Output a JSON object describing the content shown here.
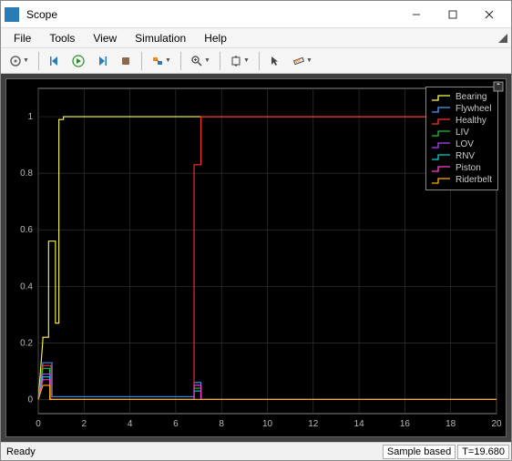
{
  "window": {
    "title": "Scope"
  },
  "menu": {
    "file": "File",
    "tools": "Tools",
    "view": "View",
    "simulation": "Simulation",
    "help": "Help"
  },
  "status": {
    "ready": "Ready",
    "mode": "Sample based",
    "time": "T=19.680"
  },
  "legend": {
    "items": [
      {
        "label": "Bearing",
        "color": "#ffff4d"
      },
      {
        "label": "Flywheel",
        "color": "#3fa0ff"
      },
      {
        "label": "Healthy",
        "color": "#ff3030"
      },
      {
        "label": "LIV",
        "color": "#20c040"
      },
      {
        "label": "LOV",
        "color": "#b040ff"
      },
      {
        "label": "RNV",
        "color": "#00d0d0"
      },
      {
        "label": "Piston",
        "color": "#ff40d0"
      },
      {
        "label": "Riderbelt",
        "color": "#ffb000"
      }
    ]
  },
  "chart_data": {
    "type": "line",
    "xlim": [
      0,
      20
    ],
    "ylim": [
      -0.05,
      1.1
    ],
    "xticks": [
      0,
      2,
      4,
      6,
      8,
      10,
      12,
      14,
      16,
      18,
      20
    ],
    "yticks": [
      0,
      0.2,
      0.4,
      0.6,
      0.8,
      1
    ],
    "series": [
      {
        "name": "Bearing",
        "color": "#ffff4d",
        "points": [
          [
            0,
            0
          ],
          [
            0.2,
            0.21
          ],
          [
            0.2,
            0.22
          ],
          [
            0.45,
            0.22
          ],
          [
            0.45,
            0.56
          ],
          [
            0.75,
            0.56
          ],
          [
            0.75,
            0.27
          ],
          [
            0.9,
            0.27
          ],
          [
            0.9,
            0.99
          ],
          [
            1.1,
            0.99
          ],
          [
            1.1,
            1.0
          ],
          [
            20,
            1.0
          ]
        ]
      },
      {
        "name": "Flywheel",
        "color": "#3fa0ff",
        "points": [
          [
            0,
            0
          ],
          [
            0.2,
            0.13
          ],
          [
            0.6,
            0.13
          ],
          [
            0.6,
            0.01
          ],
          [
            6.8,
            0.01
          ],
          [
            6.8,
            0.06
          ],
          [
            7.1,
            0.06
          ],
          [
            7.1,
            0.0
          ],
          [
            20,
            0.0
          ]
        ]
      },
      {
        "name": "Healthy",
        "color": "#ff3030",
        "points": [
          [
            0,
            0
          ],
          [
            0.2,
            0.12
          ],
          [
            0.55,
            0.12
          ],
          [
            0.55,
            0.0
          ],
          [
            6.8,
            0.0
          ],
          [
            6.8,
            0.83
          ],
          [
            7.1,
            0.83
          ],
          [
            7.1,
            1.0
          ],
          [
            20,
            1.0
          ]
        ]
      },
      {
        "name": "LIV",
        "color": "#20c040",
        "points": [
          [
            0,
            0
          ],
          [
            0.2,
            0.11
          ],
          [
            0.5,
            0.11
          ],
          [
            0.5,
            0.0
          ],
          [
            6.8,
            0.0
          ],
          [
            6.8,
            0.04
          ],
          [
            7.1,
            0.04
          ],
          [
            7.1,
            0.0
          ],
          [
            20,
            0.0
          ]
        ]
      },
      {
        "name": "LOV",
        "color": "#b040ff",
        "points": [
          [
            0,
            0
          ],
          [
            0.2,
            0.09
          ],
          [
            0.5,
            0.09
          ],
          [
            0.5,
            0.0
          ],
          [
            20,
            0.0
          ]
        ]
      },
      {
        "name": "RNV",
        "color": "#00d0d0",
        "points": [
          [
            0,
            0
          ],
          [
            0.2,
            0.08
          ],
          [
            0.5,
            0.08
          ],
          [
            0.5,
            0.0
          ],
          [
            6.8,
            0.0
          ],
          [
            6.8,
            0.03
          ],
          [
            7.1,
            0.03
          ],
          [
            7.1,
            0.0
          ],
          [
            20,
            0.0
          ]
        ]
      },
      {
        "name": "Piston",
        "color": "#ff40d0",
        "points": [
          [
            0,
            0
          ],
          [
            0.2,
            0.07
          ],
          [
            0.5,
            0.07
          ],
          [
            0.5,
            0.0
          ],
          [
            6.8,
            0.0
          ],
          [
            6.8,
            0.05
          ],
          [
            7.1,
            0.05
          ],
          [
            7.1,
            0.0
          ],
          [
            20,
            0.0
          ]
        ]
      },
      {
        "name": "Riderbelt",
        "color": "#ffb000",
        "points": [
          [
            0,
            0
          ],
          [
            0.2,
            0.05
          ],
          [
            0.5,
            0.05
          ],
          [
            0.5,
            0.0
          ],
          [
            20,
            0.0
          ]
        ]
      }
    ]
  }
}
